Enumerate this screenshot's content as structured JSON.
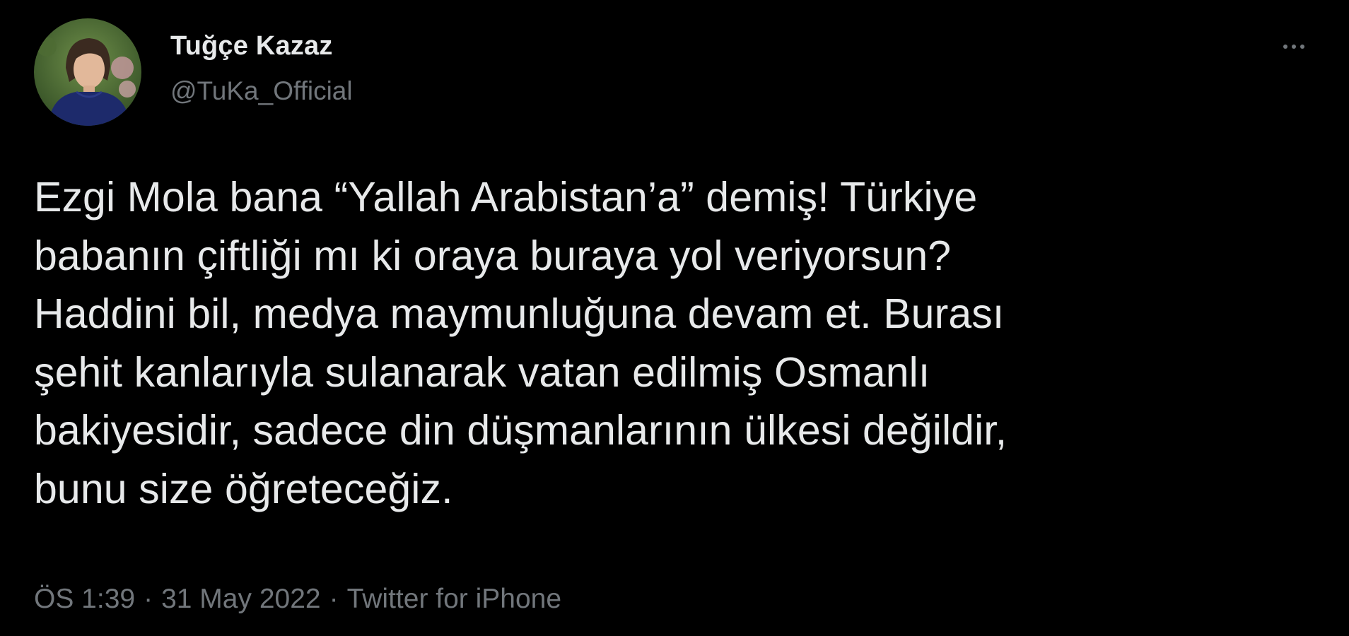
{
  "author": {
    "display_name": "Tuğçe Kazaz",
    "handle": "@TuKa_Official",
    "avatar_icon": "profile-photo"
  },
  "more_icon": "ellipsis-icon",
  "tweet": {
    "text": "Ezgi Mola bana “Yallah Arabistan’a” demiş! Türkiye\nbabanın çiftliği mı ki oraya buraya yol veriyorsun?\nHaddini bil, medya maymunluğuna devam et. Burası\nşehit kanlarıyla sulanarak vatan edilmiş Osmanlı\nbakiyesidir, sadece din düşmanlarının ülkesi değildir,\nbunu size öğreteceğiz."
  },
  "meta": {
    "time": "ÖS 1:39",
    "separator": "·",
    "date": "31 May 2022",
    "source": "Twitter for iPhone"
  },
  "colors": {
    "background": "#000000",
    "primary_text": "#e7e9ea",
    "secondary_text": "#71767b"
  }
}
